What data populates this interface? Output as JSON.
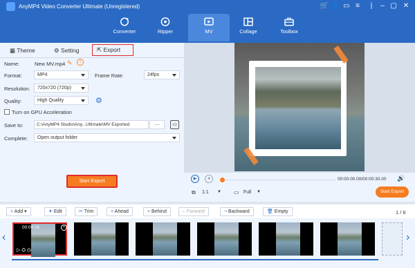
{
  "app": {
    "title": "AnyMP4 Video Converter Ultimate (Unregistered)"
  },
  "nav": {
    "items": [
      {
        "label": "Converter"
      },
      {
        "label": "Ripper"
      },
      {
        "label": "MV"
      },
      {
        "label": "Collage"
      },
      {
        "label": "Toolbox"
      }
    ],
    "active": "MV"
  },
  "subtabs": {
    "theme": "Theme",
    "setting": "Setting",
    "export": "Export"
  },
  "form": {
    "name_label": "Name:",
    "name_value": "New MV.mp4",
    "format_label": "Format:",
    "format_value": "MP4",
    "framerate_label": "Frame Rate:",
    "framerate_value": "24fps",
    "resolution_label": "Resolution:",
    "resolution_value": "720x720 (720p)",
    "quality_label": "Quality:",
    "quality_value": "High Quality",
    "gpu_label": "Turn on GPU Acceleration",
    "saveto_label": "Save to:",
    "saveto_value": "C:\\AnyMP4 Studio\\Any...Ultimate\\MV Exported",
    "browse_label": "···",
    "complete_label": "Complete:",
    "complete_value": "Open output folder"
  },
  "start_export_label": "Start Export",
  "player": {
    "time": "00:00:00.00/00:00:30.00",
    "ratio": "1:1",
    "zoom": "Full",
    "export_label": "Start Export"
  },
  "toolbar": {
    "add": "Add",
    "edit": "Edit",
    "trim": "Trim",
    "ahead": "Ahead",
    "behind": "Behind",
    "forward": "Forward",
    "backward": "Backward",
    "empty": "Empty",
    "page": "1 / 6"
  },
  "timeline": {
    "first_clip_time": "00:00:05"
  }
}
